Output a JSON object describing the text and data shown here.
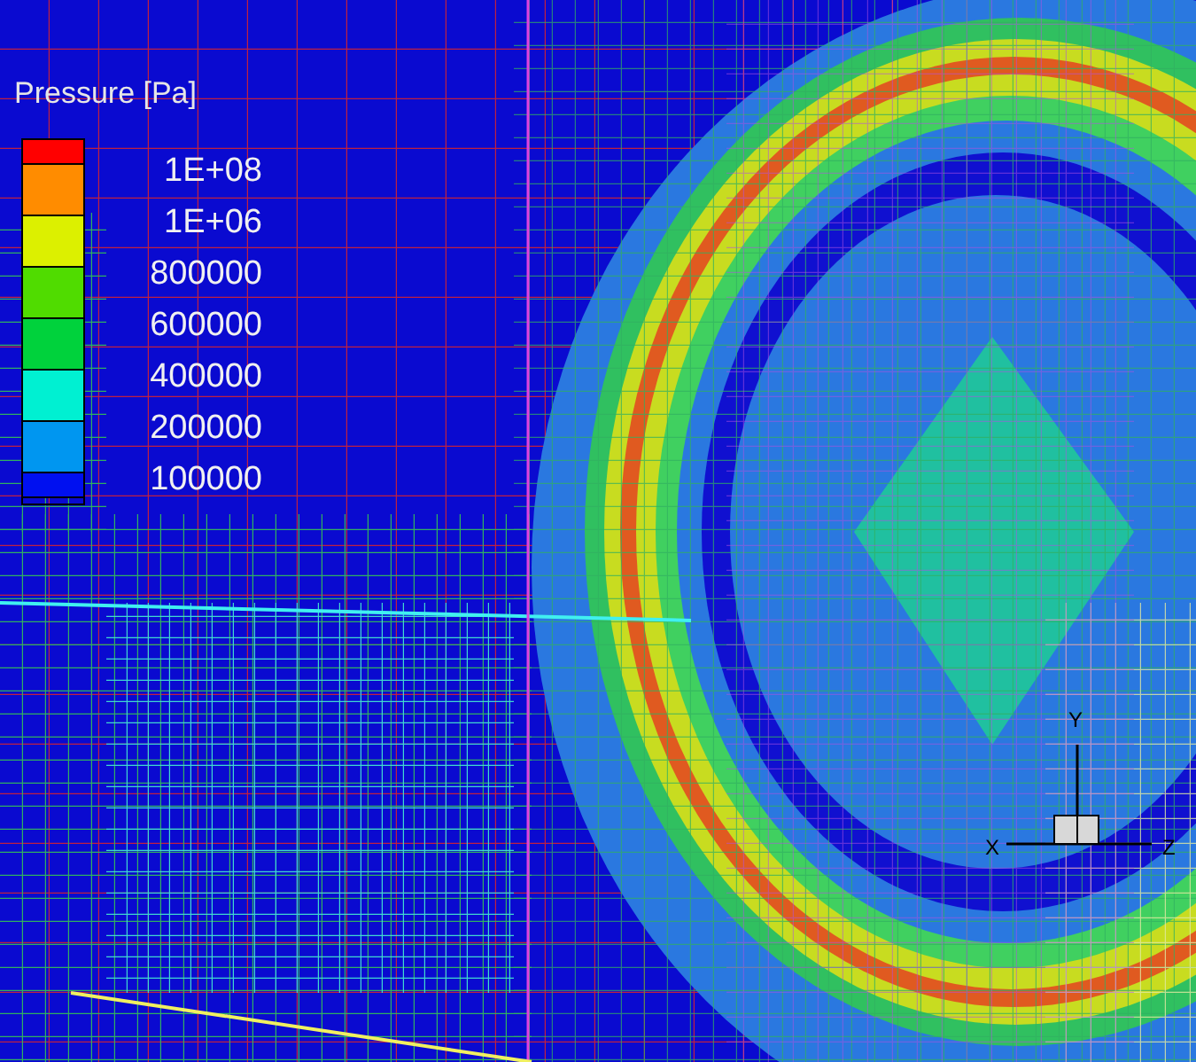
{
  "plot": {
    "legend": {
      "title": "Pressure [Pa]",
      "bands": [
        {
          "color": "#ff0000"
        },
        {
          "color": "#ff8c00"
        },
        {
          "color": "#dcf000"
        },
        {
          "color": "#50dc00"
        },
        {
          "color": "#00d23c"
        },
        {
          "color": "#00f0d2"
        },
        {
          "color": "#0096f0"
        },
        {
          "color": "#0010f0"
        }
      ],
      "labels": [
        "1E+08",
        "1E+06",
        "800000",
        "600000",
        "400000",
        "200000",
        "100000"
      ]
    },
    "triad": {
      "x_label": "X",
      "y_label": "Y",
      "z_label": "Z"
    }
  }
}
